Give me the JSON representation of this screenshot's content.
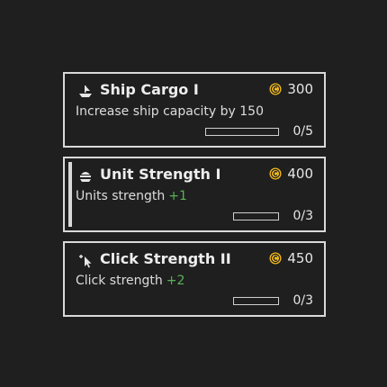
{
  "colors": {
    "background": "#1f1f1f",
    "border": "#d9d9d9",
    "coin": "#f0b81c",
    "bonus": "#58b356"
  },
  "upgrades": [
    {
      "icon": "ship-icon",
      "title": "Ship Cargo I",
      "cost": "300",
      "description": "Increase ship capacity by 150",
      "bonus": "",
      "progress": "0/5",
      "level_fraction": 0
    },
    {
      "icon": "unit-icon",
      "title": "Unit Strength I",
      "cost": "400",
      "description": "Units strength",
      "bonus": "+1",
      "progress": "0/3",
      "level_fraction": 0
    },
    {
      "icon": "cursor-click-icon",
      "title": "Click Strength II",
      "cost": "450",
      "description": "Click strength",
      "bonus": "+2",
      "progress": "0/3",
      "level_fraction": 0
    }
  ]
}
